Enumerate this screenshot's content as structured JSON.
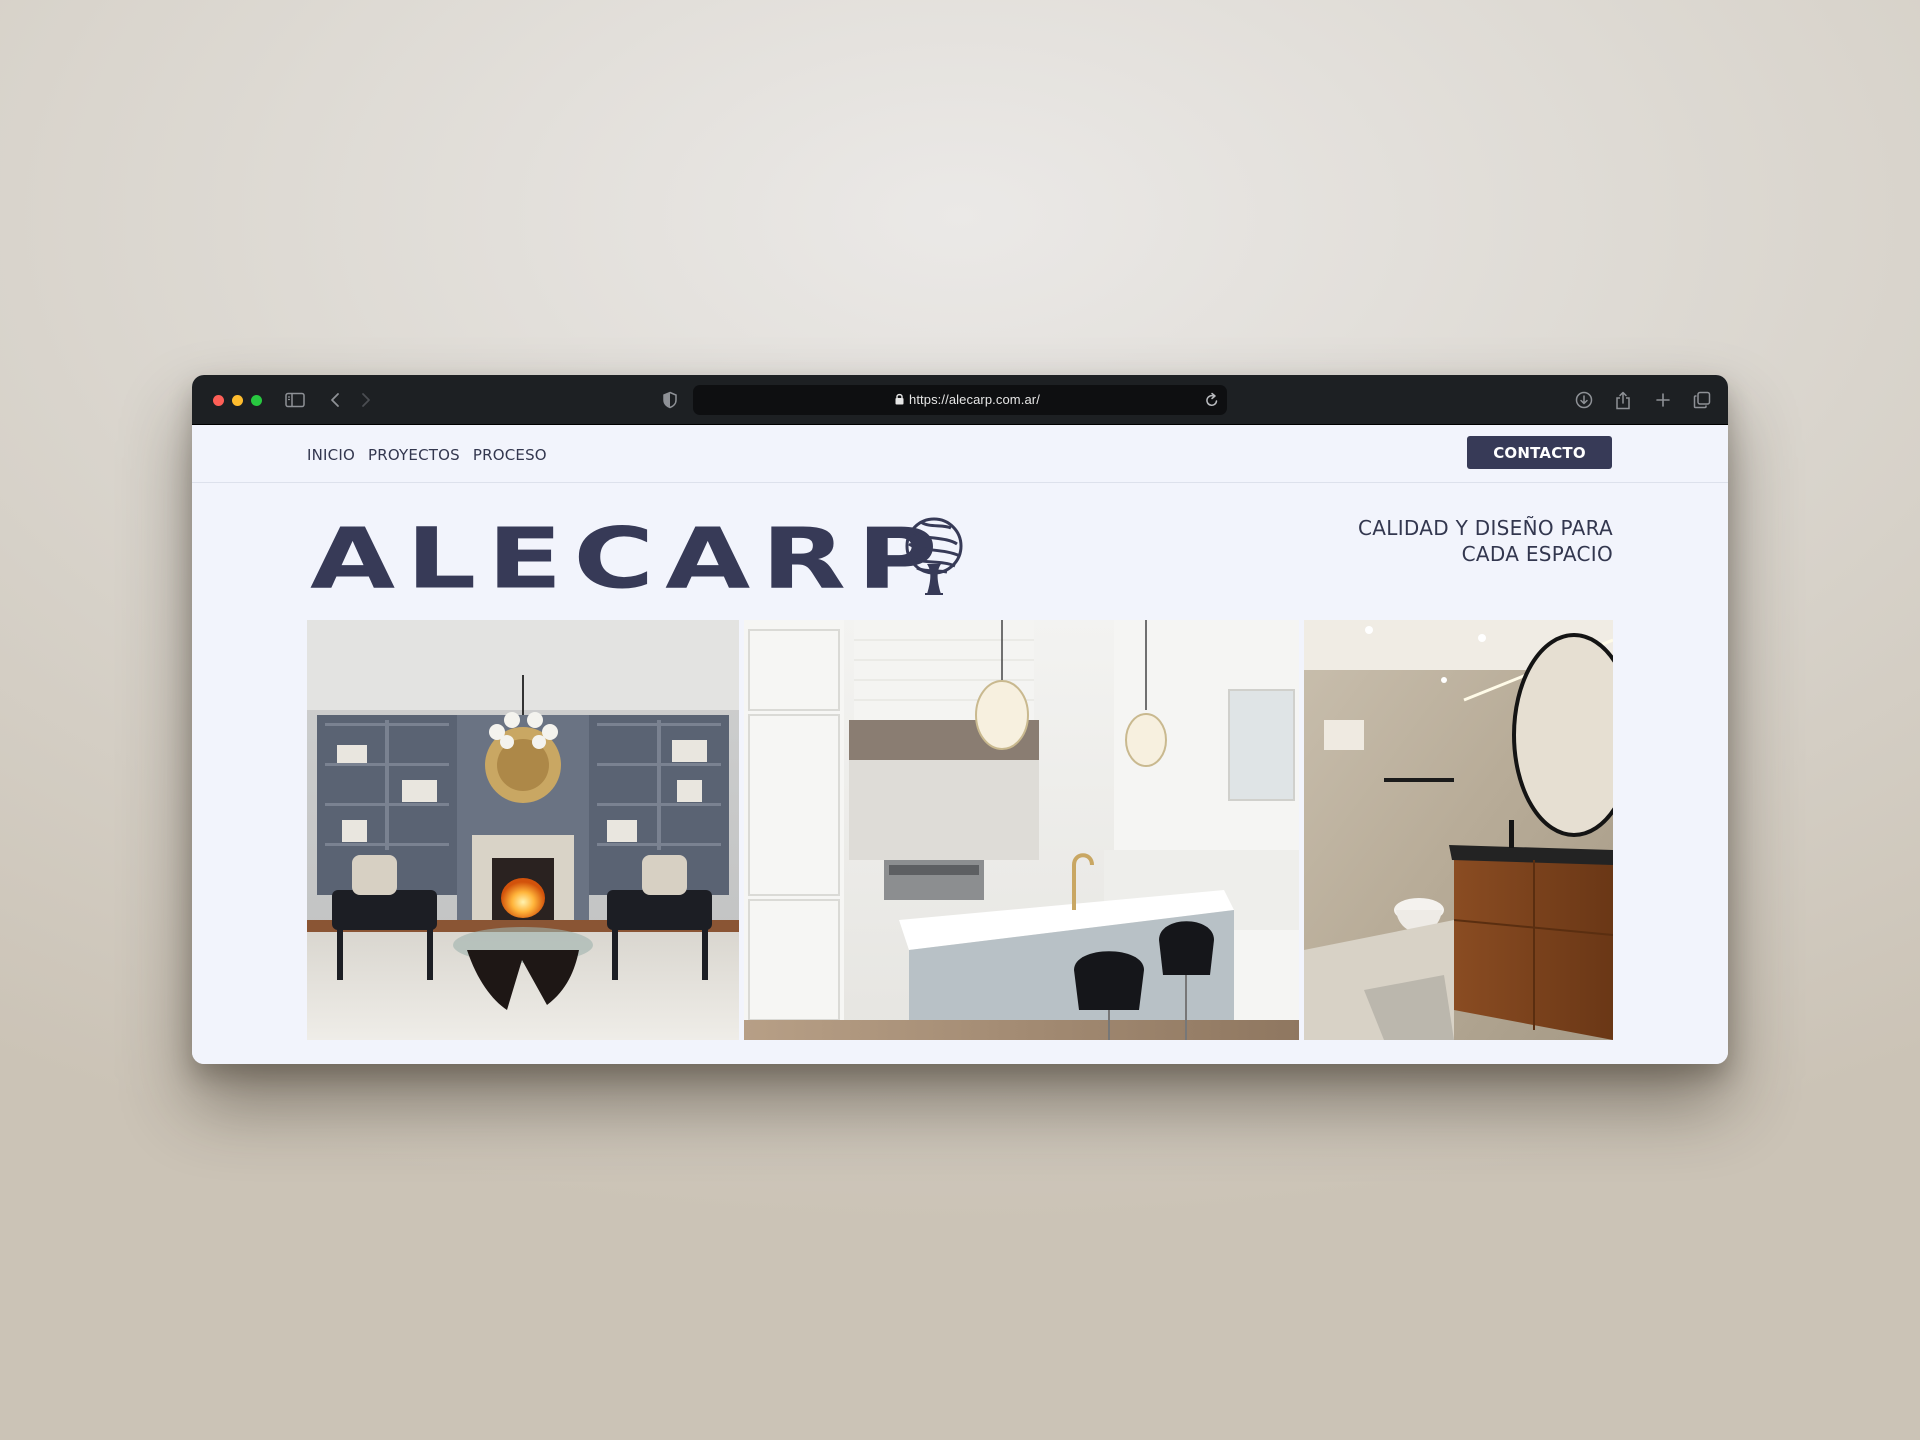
{
  "browser": {
    "url": "https://alecarp.com.ar/",
    "icons": [
      "sidebar-icon",
      "back-icon",
      "forward-icon",
      "shield-icon",
      "lock-icon",
      "reload-icon",
      "download-icon",
      "share-icon",
      "new-tab-icon",
      "tabs-icon"
    ]
  },
  "nav": {
    "links": [
      "INICIO",
      "PROYECTOS",
      "PROCESO"
    ],
    "contact_label": "CONTACTO"
  },
  "hero": {
    "logo_text": "ALECARP",
    "tagline_line1": "CALIDAD Y DISEÑO PARA",
    "tagline_line2": "CADA ESPACIO"
  },
  "colors": {
    "brand": "#373a57",
    "page_bg": "#f2f4fc",
    "toolbar_bg": "#1d2023"
  }
}
